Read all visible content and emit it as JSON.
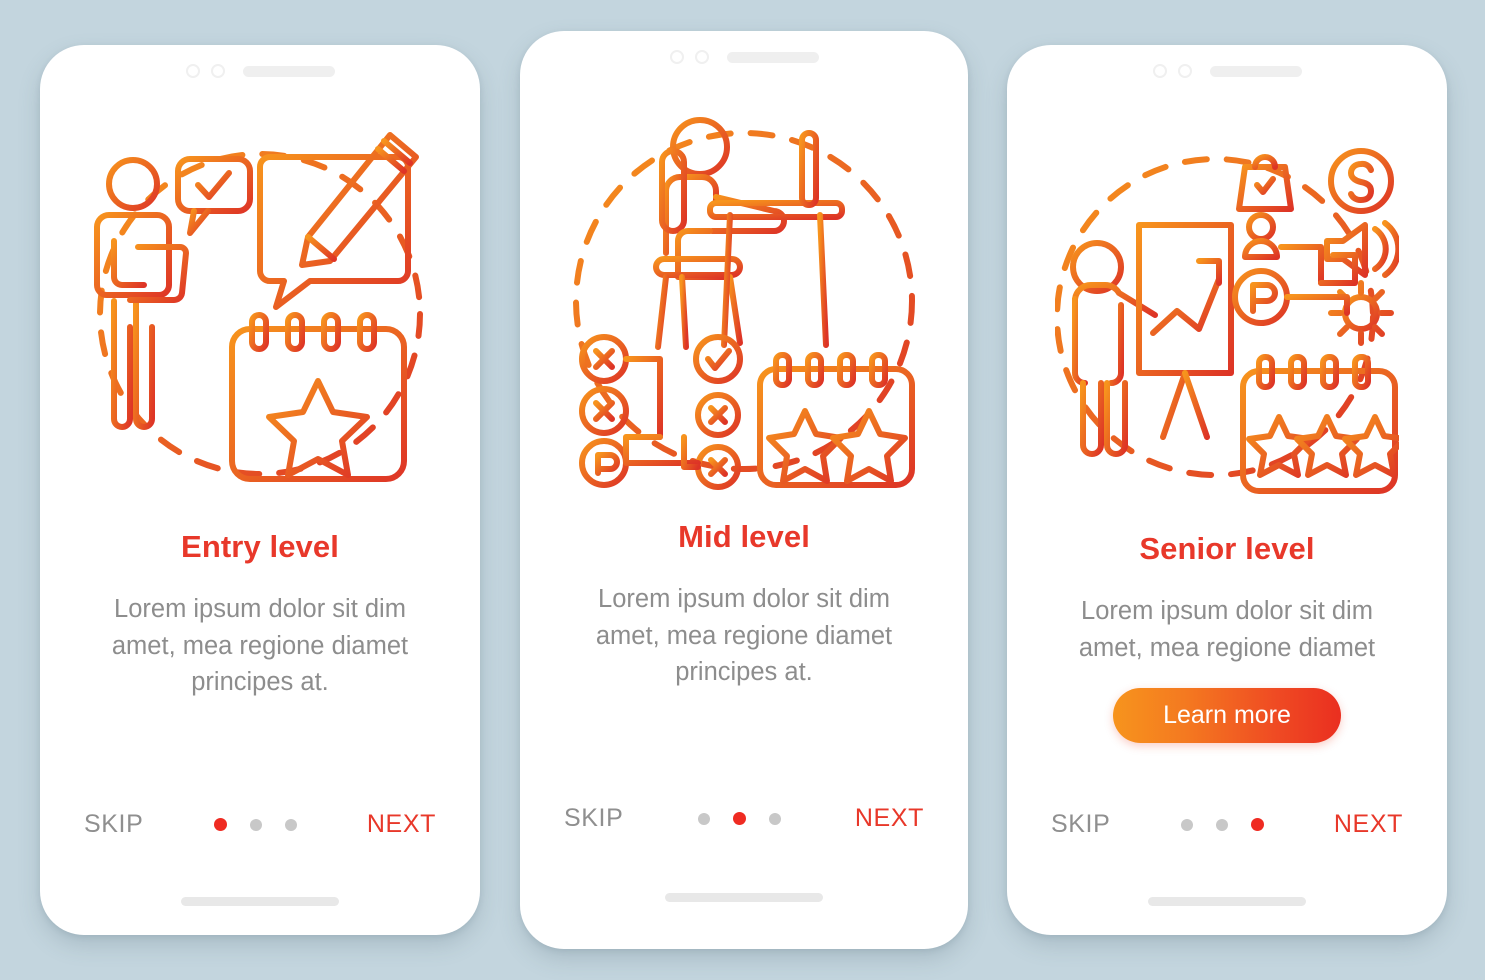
{
  "theme": {
    "background": "#c3d5de",
    "phone_surface": "#ffffff",
    "title_color": "#e8382a",
    "body_text_color": "#8d8d8d",
    "skip_color": "#8f8f8f",
    "next_color": "#e8382a",
    "dot_inactive": "#c8c8c8",
    "dot_active": "#ef2b22",
    "illustration_gradient_start": "#f7941d",
    "illustration_gradient_end": "#e0362a",
    "cta_gradient_start": "#f7941d",
    "cta_gradient_end": "#ea2f20"
  },
  "screens": [
    {
      "id": "entry-level",
      "title": "Entry level",
      "description": "Lorem ipsum dolor sit dim amet, mea regione diamet principes at.",
      "illustration_name": "person-with-notes-and-calendar-one-star",
      "skip_label": "SKIP",
      "next_label": "NEXT",
      "active_dot_index": 0,
      "dot_count": 3,
      "cta": null
    },
    {
      "id": "mid-level",
      "title": "Mid level",
      "description": "Lorem ipsum dolor sit dim amet, mea regione diamet principes at.",
      "illustration_name": "person-at-desk-with-task-tree-and-calendar-two-stars",
      "skip_label": "SKIP",
      "next_label": "NEXT",
      "active_dot_index": 1,
      "dot_count": 3,
      "cta": null
    },
    {
      "id": "senior-level",
      "title": "Senior level",
      "description": "Lorem ipsum dolor sit dim amet, mea regione diamet",
      "illustration_name": "presenter-with-chart-icons-and-calendar-three-stars",
      "skip_label": "SKIP",
      "next_label": "NEXT",
      "active_dot_index": 2,
      "dot_count": 3,
      "cta": "Learn more"
    }
  ],
  "statusbar": {
    "camera_icon": "camera-dot-icon",
    "sensor_icon": "sensor-dot-icon",
    "speaker_icon": "speaker-grille-icon"
  },
  "home_indicator": "home-indicator-bar"
}
